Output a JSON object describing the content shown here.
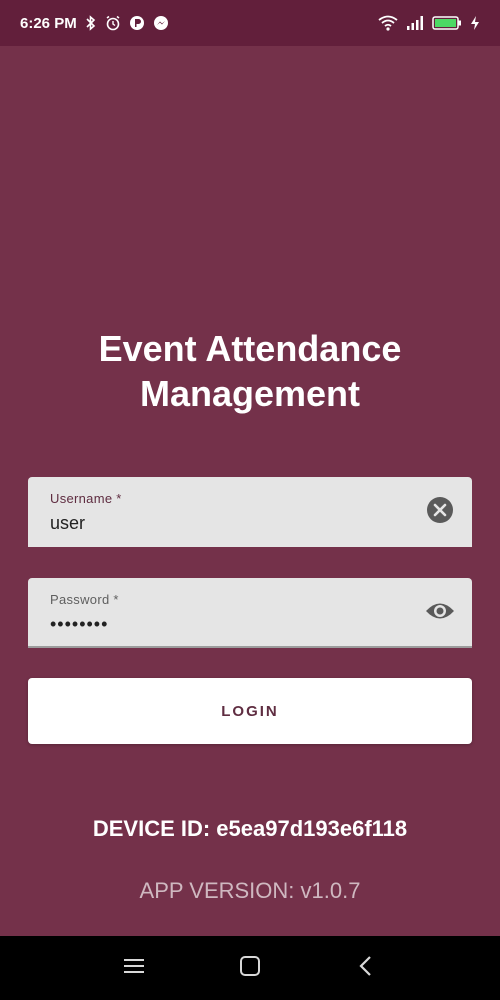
{
  "status_bar": {
    "time": "6:26 PM",
    "icons": [
      "bluetooth-icon",
      "alarm-icon",
      "app-notification-icon",
      "messenger-icon",
      "wifi-icon",
      "signal-icon",
      "battery-icon",
      "charging-icon"
    ]
  },
  "title": {
    "line1": "Event Attendance",
    "line2": "Management"
  },
  "username": {
    "label": "Username *",
    "value": "user"
  },
  "password": {
    "label": "Password *",
    "value": "••••••••"
  },
  "login_label": "LOGIN",
  "device_id": "DEVICE ID: e5ea97d193e6f118",
  "app_version": "APP VERSION: v1.0.7",
  "colors": {
    "background": "#74314a",
    "status_bar": "#621f3b",
    "field_bg": "#e5e5e5",
    "accent": "#5f2d41"
  }
}
